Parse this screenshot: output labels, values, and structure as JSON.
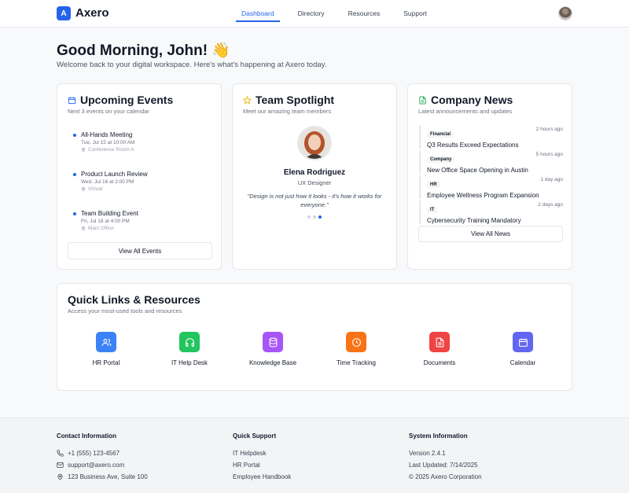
{
  "brand": {
    "logo_letter": "A",
    "name": "Axero",
    "color": "#2563eb"
  },
  "nav": [
    {
      "label": "Dashboard",
      "active": true
    },
    {
      "label": "Directory",
      "active": false
    },
    {
      "label": "Resources",
      "active": false
    },
    {
      "label": "Support",
      "active": false
    }
  ],
  "greeting": {
    "title": "Good Morning, John! 👋",
    "subtitle": "Welcome back to your digital workspace. Here's what's happening at Axero today."
  },
  "events": {
    "title": "Upcoming Events",
    "subtitle": "Next 3 events on your calendar",
    "items": [
      {
        "title": "All-Hands Meeting",
        "date": "Tue, Jul 15 at 10:00 AM",
        "location": "Conference Room A"
      },
      {
        "title": "Product Launch Review",
        "date": "Wed, Jul 16 at 2:00 PM",
        "location": "Virtual"
      },
      {
        "title": "Team Building Event",
        "date": "Fri, Jul 18 at 4:00 PM",
        "location": "Main Office"
      }
    ],
    "button": "View All Events"
  },
  "spotlight": {
    "title": "Team Spotlight",
    "subtitle": "Meet our amazing team members",
    "name": "Elena Rodriguez",
    "role": "UX Designer",
    "quote": "\"Design is not just how it looks - it's how it works for everyone.\""
  },
  "news": {
    "title": "Company News",
    "subtitle": "Latest announcements and updates",
    "items": [
      {
        "tag": "Financial",
        "time": "2 hours ago",
        "title": "Q3 Results Exceed Expectations"
      },
      {
        "tag": "Company",
        "time": "5 hours ago",
        "title": "New Office Space Opening in Austin"
      },
      {
        "tag": "HR",
        "time": "1 day ago",
        "title": "Employee Wellness Program Expansion"
      },
      {
        "tag": "IT",
        "time": "2 days ago",
        "title": "Cybersecurity Training Mandatory"
      }
    ],
    "button": "View All News"
  },
  "quicklinks": {
    "title": "Quick Links & Resources",
    "subtitle": "Access your most-used tools and resources",
    "items": [
      {
        "label": "HR Portal",
        "icon": "users-icon",
        "color": "#3b82f6"
      },
      {
        "label": "IT Help Desk",
        "icon": "headphones-icon",
        "color": "#22c55e"
      },
      {
        "label": "Knowledge Base",
        "icon": "database-icon",
        "color": "#a855f7"
      },
      {
        "label": "Time Tracking",
        "icon": "clock-icon",
        "color": "#f97316"
      },
      {
        "label": "Documents",
        "icon": "document-icon",
        "color": "#ef4444"
      },
      {
        "label": "Calendar",
        "icon": "calendar-icon",
        "color": "#6366f1"
      }
    ]
  },
  "footer": {
    "contact": {
      "heading": "Contact Information",
      "phone": "+1 (555) 123-4567",
      "email": "support@axero.com",
      "address": "123 Business Ave, Suite 100"
    },
    "support": {
      "heading": "Quick Support",
      "links": [
        "IT Helpdesk",
        "HR Portal",
        "Employee Handbook"
      ]
    },
    "system": {
      "heading": "System Information",
      "version": "Version 2.4.1",
      "updated": "Last Updated: 7/14/2025",
      "copyright": "© 2025 Axero Corporation"
    }
  }
}
